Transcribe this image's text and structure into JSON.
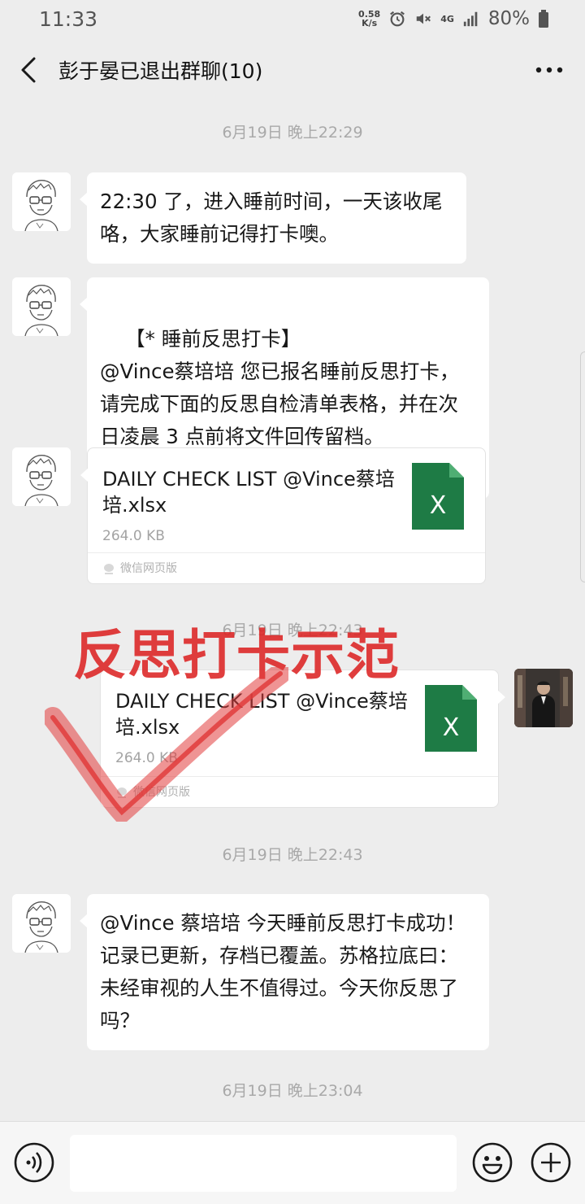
{
  "status_bar": {
    "time": "11:33",
    "net_speed_value": "0.58",
    "net_speed_unit": "K/s",
    "network": "4G",
    "battery": "80%"
  },
  "header": {
    "title": "彭于晏已退出群聊(10)"
  },
  "messages": [
    {
      "type": "timestamp",
      "text": "6月19日 晚上22:29"
    },
    {
      "type": "text",
      "side": "left",
      "text": "22:30 了，进入睡前时间，一天该收尾咯，大家睡前记得打卡噢。"
    },
    {
      "type": "text",
      "side": "left",
      "text": "【* 睡前反思打卡】\n@Vince蔡培培 您已报名睡前反思打卡，请完成下面的反思自检清单表格，并在次日凌晨 3 点前将文件回传留档。"
    },
    {
      "type": "file",
      "side": "left",
      "file_name": "DAILY CHECK LIST @Vince蔡培培.xlsx",
      "file_size": "264.0 KB",
      "source": "微信网页版"
    },
    {
      "type": "timestamp",
      "text": "6月19日 晚上22:43"
    },
    {
      "type": "file",
      "side": "right",
      "file_name": "DAILY CHECK LIST @Vince蔡培培.xlsx",
      "file_size": "264.0 KB",
      "source": "微信网页版"
    },
    {
      "type": "timestamp",
      "text": "6月19日 晚上22:43"
    },
    {
      "type": "text",
      "side": "left",
      "text": "@Vince 蔡培培 今天睡前反思打卡成功！记录已更新，存档已覆盖。苏格拉底曰：未经审视的人生不值得过。今天你反思了吗？"
    },
    {
      "type": "timestamp",
      "text": "6月19日 晚上23:04"
    }
  ],
  "overlay": {
    "text": "反思打卡示范",
    "color": "#dc2323"
  },
  "icons": {
    "back": "chevron-left-icon",
    "more": "more-dots-icon",
    "voice": "voice-icon",
    "emoji": "emoji-icon",
    "plus": "plus-icon",
    "excel": "excel-file-icon"
  },
  "colors": {
    "background": "#ededed",
    "bubble": "#ffffff",
    "excel_green": "#1e7b45"
  }
}
